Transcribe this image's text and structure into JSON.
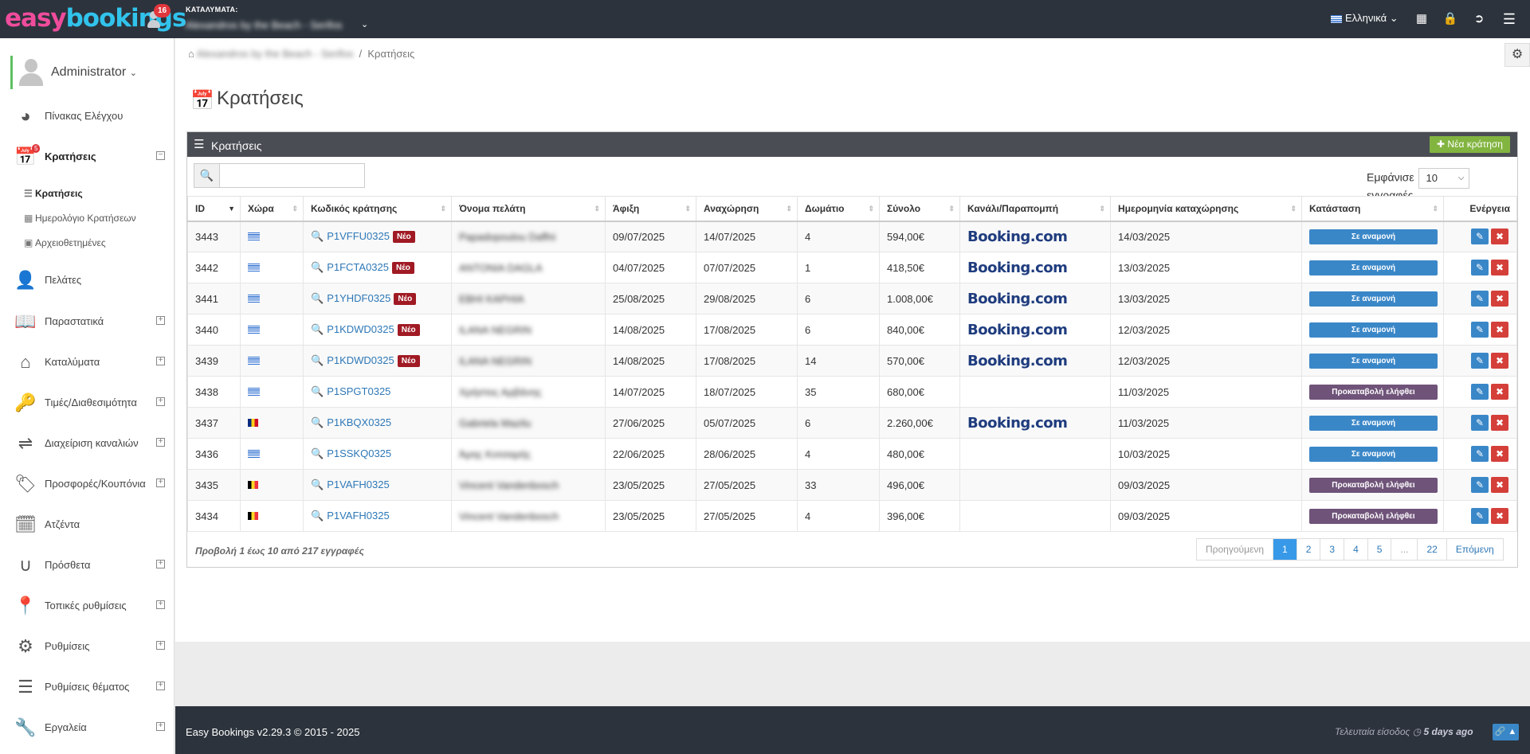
{
  "app": {
    "logo_part1": "easy",
    "logo_part2": "bookings",
    "alert_count": "16",
    "property_label": "ΚΑΤΑΛΥΜΑΤΑ:",
    "property_name": "Alexandros by the Beach - Serifos",
    "language": "Ελληνικά"
  },
  "sidebar": {
    "user": "Administrator",
    "items": [
      {
        "label": "Πίνακας Ελέγχου"
      },
      {
        "label": "Κρατήσεις",
        "badge": "5"
      },
      {
        "label": "Πελάτες"
      },
      {
        "label": "Παραστατικά"
      },
      {
        "label": "Καταλύματα"
      },
      {
        "label": "Τιμές/Διαθεσιμότητα"
      },
      {
        "label": "Διαχείριση καναλιών"
      },
      {
        "label": "Προσφορές/Κουπόνια"
      },
      {
        "label": "Ατζέντα"
      },
      {
        "label": "Πρόσθετα"
      },
      {
        "label": "Τοπικές ρυθμίσεις"
      },
      {
        "label": "Ρυθμίσεις"
      },
      {
        "label": "Ρυθμίσεις θέματος"
      },
      {
        "label": "Εργαλεία"
      }
    ],
    "subitems": [
      {
        "label": "Κρατήσεις"
      },
      {
        "label": "Ημερολόγιο Κρατήσεων"
      },
      {
        "label": "Αρχειοθετημένες"
      }
    ]
  },
  "breadcrumb": {
    "property": "Alexandros by the Beach - Serifos",
    "current": "Κρατήσεις"
  },
  "page": {
    "title": "Κρατήσεις"
  },
  "panel": {
    "title": "Κρατήσεις",
    "new_button": "Νέα κράτηση",
    "show_label": "Εμφάνισε",
    "page_size": "10",
    "records_label": "εγγραφές"
  },
  "table": {
    "headers": [
      "ID",
      "Χώρα",
      "Κωδικός κράτησης",
      "Όνομα πελάτη",
      "Άφιξη",
      "Αναχώρηση",
      "Δωμάτιο",
      "Σύνολο",
      "Κανάλι/Παραπομπή",
      "Ημερομηνία καταχώρησης",
      "Κατάσταση",
      "Ενέργεια"
    ],
    "new_label": "Νέο",
    "rows": [
      {
        "id": "3443",
        "code": "P1VFFU0325",
        "guest": "Papadopoulou Daffni",
        "arrival": "09/07/2025",
        "departure": "14/07/2025",
        "room": "4",
        "total": "594,00€",
        "channel": "Booking.com",
        "date": "14/03/2025",
        "status": "Σε αναμονή"
      },
      {
        "id": "3442",
        "code": "P1FCTA0325",
        "guest": "ANTONIA DAGLA",
        "arrival": "04/07/2025",
        "departure": "07/07/2025",
        "room": "1",
        "total": "418,50€",
        "channel": "Booking.com",
        "date": "13/03/2025",
        "status": "Σε αναμονή"
      },
      {
        "id": "3441",
        "code": "P1YHDF0325",
        "guest": "EBHI KAPHIA",
        "arrival": "25/08/2025",
        "departure": "29/08/2025",
        "room": "6",
        "total": "1.008,00€",
        "channel": "Booking.com",
        "date": "13/03/2025",
        "status": "Σε αναμονή"
      },
      {
        "id": "3440",
        "code": "P1KDWD0325",
        "guest": "ILANA NEGRIN",
        "arrival": "14/08/2025",
        "departure": "17/08/2025",
        "room": "6",
        "total": "840,00€",
        "channel": "Booking.com",
        "date": "12/03/2025",
        "status": "Σε αναμονή"
      },
      {
        "id": "3439",
        "code": "P1KDWD0325",
        "guest": "ILANA NEGRIN",
        "arrival": "14/08/2025",
        "departure": "17/08/2025",
        "room": "14",
        "total": "570,00€",
        "channel": "Booking.com",
        "date": "12/03/2025",
        "status": "Σε αναμονή"
      },
      {
        "id": "3438",
        "code": "P1SPGT0325",
        "guest": "Χρήστος Αρβάνης",
        "arrival": "14/07/2025",
        "departure": "18/07/2025",
        "room": "35",
        "total": "680,00€",
        "channel": "",
        "date": "11/03/2025",
        "status": "Προκαταβολή ελήφθει"
      },
      {
        "id": "3437",
        "code": "P1KBQX0325",
        "guest": "Gabriela Mazilu",
        "arrival": "27/06/2025",
        "departure": "05/07/2025",
        "room": "6",
        "total": "2.260,00€",
        "channel": "Booking.com",
        "date": "11/03/2025",
        "status": "Σε αναμονή"
      },
      {
        "id": "3436",
        "code": "P1SSKQ0325",
        "guest": "Άρης Κοτσαρής",
        "arrival": "22/06/2025",
        "departure": "28/06/2025",
        "room": "4",
        "total": "480,00€",
        "channel": "",
        "date": "10/03/2025",
        "status": "Σε αναμονή"
      },
      {
        "id": "3435",
        "code": "P1VAFH0325",
        "guest": "Vincent Vandenbosch",
        "arrival": "23/05/2025",
        "departure": "27/05/2025",
        "room": "33",
        "total": "496,00€",
        "channel": "",
        "date": "09/03/2025",
        "status": "Προκαταβολή ελήφθει"
      },
      {
        "id": "3434",
        "code": "P1VAFH0325",
        "guest": "Vincent Vandenbosch",
        "arrival": "23/05/2025",
        "departure": "27/05/2025",
        "room": "4",
        "total": "396,00€",
        "channel": "",
        "date": "09/03/2025",
        "status": "Προκαταβολή ελήφθει"
      }
    ]
  },
  "pagination": {
    "info": "Προβολή 1 έως 10 από 217 εγγραφές",
    "prev": "Προηγούμενη",
    "pages": [
      "1",
      "2",
      "3",
      "4",
      "5",
      "...",
      "22"
    ],
    "next": "Επόμενη"
  },
  "footer": {
    "copyright": "Easy Bookings v2.29.3 © 2015 - 2025",
    "last_login_label": "Τελευταία είσοδος",
    "last_login_value": "5 days ago"
  },
  "colors": {
    "topbar": "#2c333c",
    "accent": "#3a87c8",
    "new_button": "#82b440",
    "badge_new": "#a01a24",
    "status_paid": "#6f5379"
  }
}
